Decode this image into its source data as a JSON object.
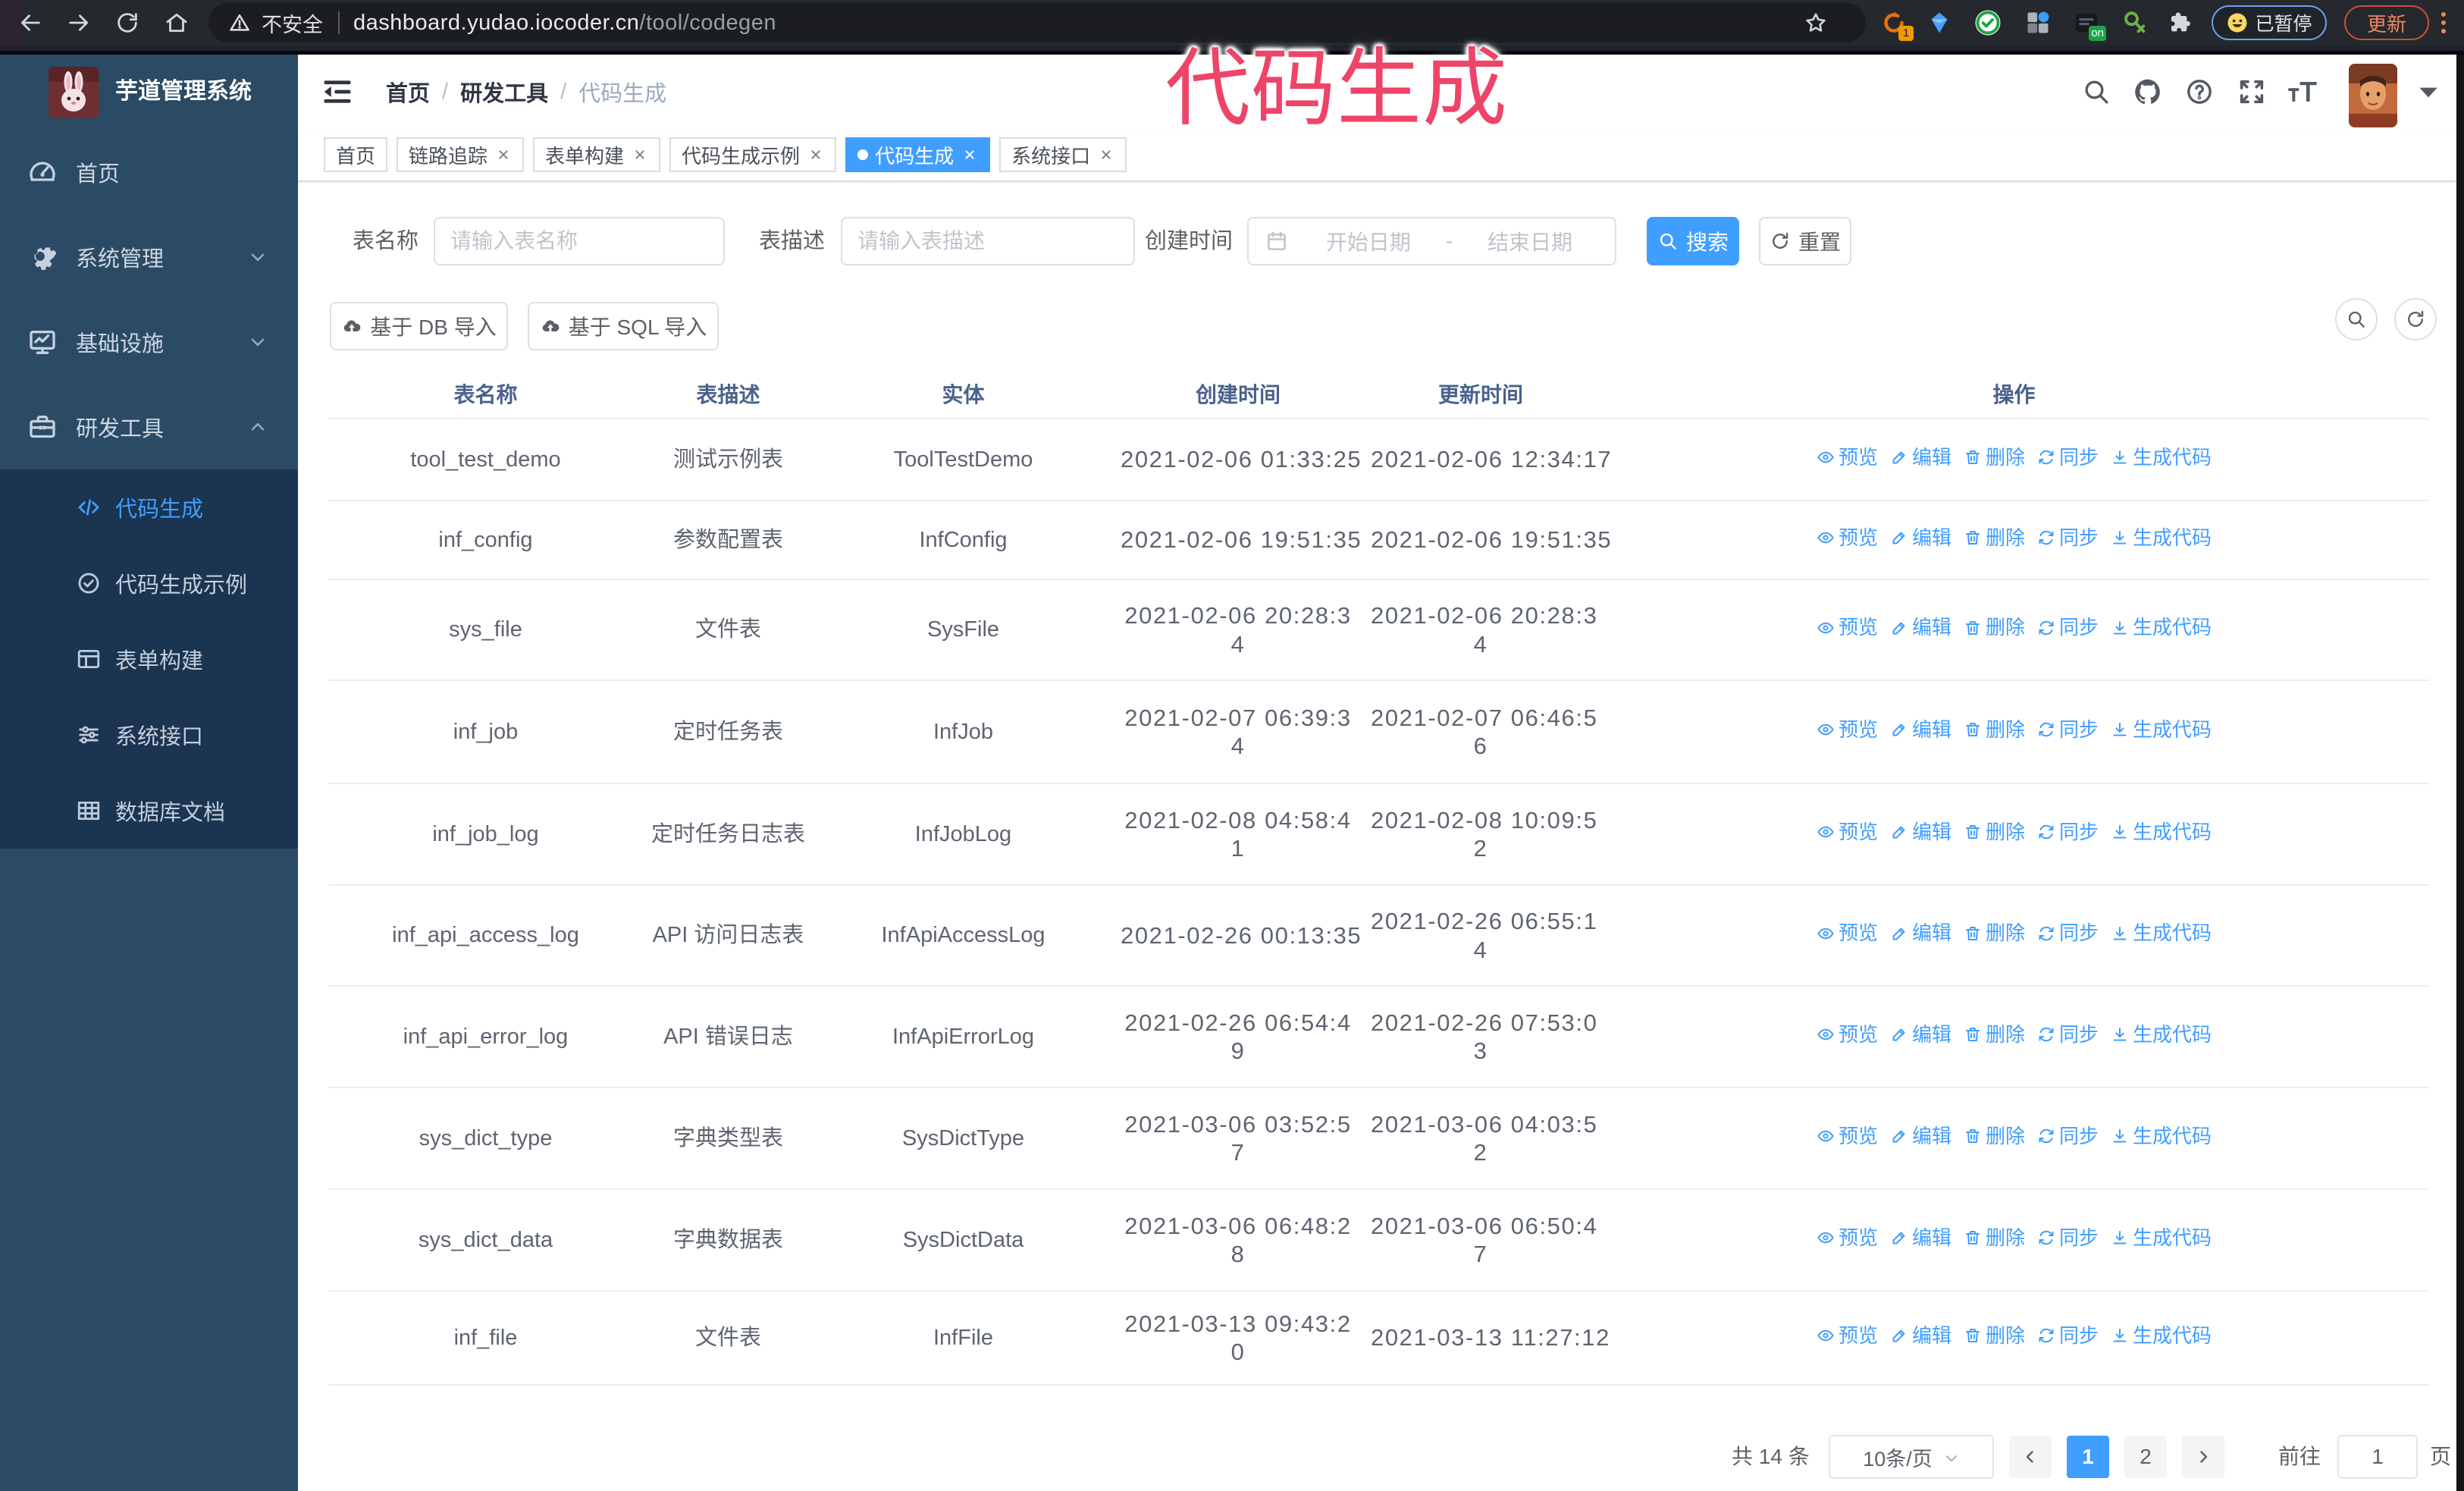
{
  "browser": {
    "security_label": "不安全",
    "url_host": "dashboard.yudao.iocoder.cn",
    "url_path": "/tool/codegen",
    "paused_label": "已暂停",
    "update_label": "更新"
  },
  "annotation": {
    "text": "代码生成",
    "color": "#ee4468"
  },
  "sidebar": {
    "logo_title": "芋道管理系统",
    "items": [
      {
        "label": "首页",
        "icon": "dashboard-icon",
        "expandable": false
      },
      {
        "label": "系统管理",
        "icon": "gear-icon",
        "expandable": true,
        "expanded": false
      },
      {
        "label": "基础设施",
        "icon": "infra-icon",
        "expandable": true,
        "expanded": false
      },
      {
        "label": "研发工具",
        "icon": "toolbox-icon",
        "expandable": true,
        "expanded": true
      }
    ],
    "submenu": [
      {
        "label": "代码生成",
        "icon": "code-icon",
        "active": true
      },
      {
        "label": "代码生成示例",
        "icon": "badge-check-icon",
        "active": false
      },
      {
        "label": "表单构建",
        "icon": "form-icon",
        "active": false
      },
      {
        "label": "系统接口",
        "icon": "sliders-icon",
        "active": false
      },
      {
        "label": "数据库文档",
        "icon": "table-grid-icon",
        "active": false
      }
    ]
  },
  "navbar": {
    "breadcrumb": [
      {
        "label": "首页"
      },
      {
        "label": "研发工具"
      },
      {
        "label": "代码生成"
      }
    ],
    "separator": "/"
  },
  "tabs": [
    {
      "label": "首页",
      "closable": false,
      "active": false
    },
    {
      "label": "链路追踪",
      "closable": true,
      "active": false
    },
    {
      "label": "表单构建",
      "closable": true,
      "active": false
    },
    {
      "label": "代码生成示例",
      "closable": true,
      "active": false
    },
    {
      "label": "代码生成",
      "closable": true,
      "active": true
    },
    {
      "label": "系统接口",
      "closable": true,
      "active": false
    }
  ],
  "filter": {
    "name_label": "表名称",
    "name_placeholder": "请输入表名称",
    "desc_label": "表描述",
    "desc_placeholder": "请输入表描述",
    "time_label": "创建时间",
    "start_placeholder": "开始日期",
    "range_separator": "-",
    "end_placeholder": "结束日期",
    "search_label": "搜索",
    "reset_label": "重置",
    "import_db_label": "基于 DB 导入",
    "import_sql_label": "基于 SQL 导入"
  },
  "table": {
    "columns": [
      "表名称",
      "表描述",
      "实体",
      "创建时间",
      "更新时间",
      "操作"
    ],
    "actions": [
      "预览",
      "编辑",
      "删除",
      "同步",
      "生成代码"
    ],
    "action_icons": [
      "eye-icon",
      "edit-icon",
      "delete-icon",
      "sync-icon",
      "download-icon"
    ],
    "rows": [
      {
        "name": "tool_test_demo",
        "desc": "测试示例表",
        "entity": "ToolTestDemo",
        "created": "2021-02-06 01:33:25",
        "updated": "2021-02-06 12:34:17"
      },
      {
        "name": "inf_config",
        "desc": "参数配置表",
        "entity": "InfConfig",
        "created": "2021-02-06 19:51:35",
        "updated": "2021-02-06 19:51:35"
      },
      {
        "name": "sys_file",
        "desc": "文件表",
        "entity": "SysFile",
        "created": "2021-02-06 20:28:3\n4",
        "updated": "2021-02-06 20:28:3\n4"
      },
      {
        "name": "inf_job",
        "desc": "定时任务表",
        "entity": "InfJob",
        "created": "2021-02-07 06:39:3\n4",
        "updated": "2021-02-07 06:46:5\n6"
      },
      {
        "name": "inf_job_log",
        "desc": "定时任务日志表",
        "entity": "InfJobLog",
        "created": "2021-02-08 04:58:4\n1",
        "updated": "2021-02-08 10:09:5\n2"
      },
      {
        "name": "inf_api_access_log",
        "desc": "API 访问日志表",
        "entity": "InfApiAccessLog",
        "created": "2021-02-26 00:13:35",
        "updated": "2021-02-26 06:55:1\n4"
      },
      {
        "name": "inf_api_error_log",
        "desc": "API 错误日志",
        "entity": "InfApiErrorLog",
        "created": "2021-02-26 06:54:4\n9",
        "updated": "2021-02-26 07:53:0\n3"
      },
      {
        "name": "sys_dict_type",
        "desc": "字典类型表",
        "entity": "SysDictType",
        "created": "2021-03-06 03:52:5\n7",
        "updated": "2021-03-06 04:03:5\n2"
      },
      {
        "name": "sys_dict_data",
        "desc": "字典数据表",
        "entity": "SysDictData",
        "created": "2021-03-06 06:48:2\n8",
        "updated": "2021-03-06 06:50:4\n7"
      },
      {
        "name": "inf_file",
        "desc": "文件表",
        "entity": "InfFile",
        "created": "2021-03-13 09:43:2\n0",
        "updated": "2021-03-13 11:27:12"
      }
    ]
  },
  "pagination": {
    "total_text": "共 14 条",
    "page_size_text": "10条/页",
    "pages": [
      "1",
      "2"
    ],
    "active_page": "1",
    "goto_label": "前往",
    "goto_value": "1",
    "page_suffix": "页"
  },
  "colors": {
    "accent": "#409eff",
    "annotation_pink": "#ee4468",
    "sidebar_bg": "#2b4a64",
    "submenu_bg": "#1b3450",
    "chrome_bg": "#25282c",
    "update_orange": "#e8714f"
  }
}
